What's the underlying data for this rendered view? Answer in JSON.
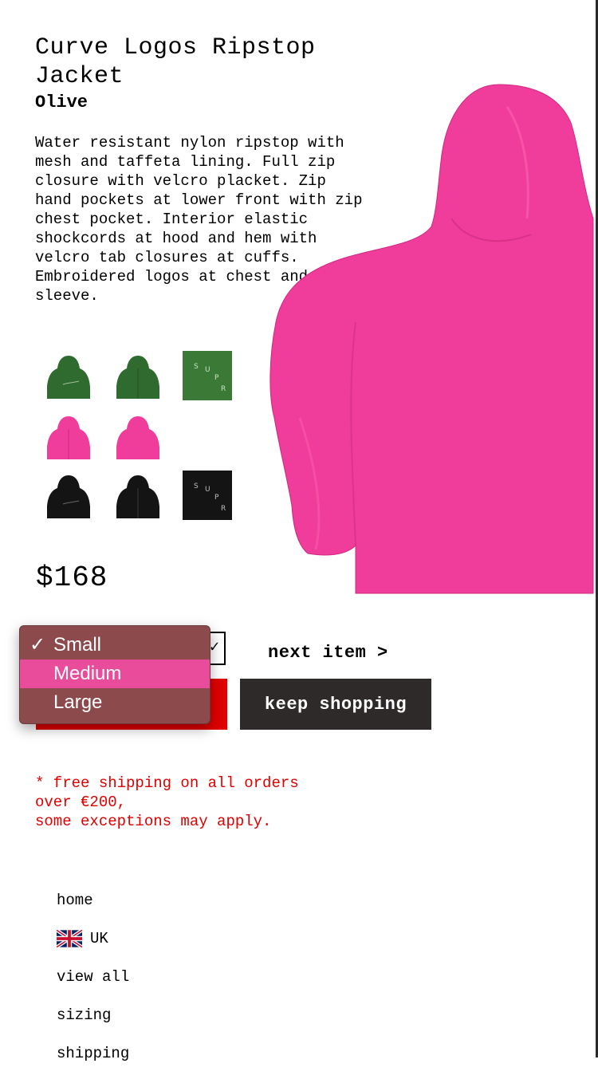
{
  "product": {
    "title": "Curve Logos Ripstop Jacket",
    "color": "Olive",
    "description": "Water resistant nylon ripstop with mesh and taffeta lining. Full zip closure with velcro placket. Zip hand pockets at lower front with zip chest pocket. Interior elastic shockcords at hood and hem with velcro tab closures at cuffs. Embroidered logos at chest and sleeve.",
    "price": "$168",
    "main_image_color": "#f03c9a"
  },
  "swatches": {
    "colors": {
      "green": "#2f6a2e",
      "pink": "#f03c9a",
      "black": "#141414"
    },
    "rows": [
      {
        "color": "green",
        "items": [
          "jacket-back",
          "jacket-front",
          "logo-detail"
        ]
      },
      {
        "color": "pink",
        "items": [
          "jacket-back",
          "jacket-front"
        ]
      },
      {
        "color": "black",
        "items": [
          "jacket-back",
          "jacket-front",
          "logo-detail"
        ]
      }
    ]
  },
  "size_dropdown": {
    "options": [
      "Small",
      "Medium",
      "Large"
    ],
    "selected": "Small",
    "highlighted": "Medium",
    "check_glyph": "✓"
  },
  "actions": {
    "next_item": "next item >",
    "keep_shopping": "keep shopping",
    "add_button_color": "#e00000"
  },
  "shipping_note": "* free shipping on all orders\nover €200,\nsome exceptions may apply.",
  "footer_nav": {
    "home": "home",
    "region": "UK",
    "view_all": "view all",
    "sizing": "sizing",
    "shipping": "shipping"
  }
}
